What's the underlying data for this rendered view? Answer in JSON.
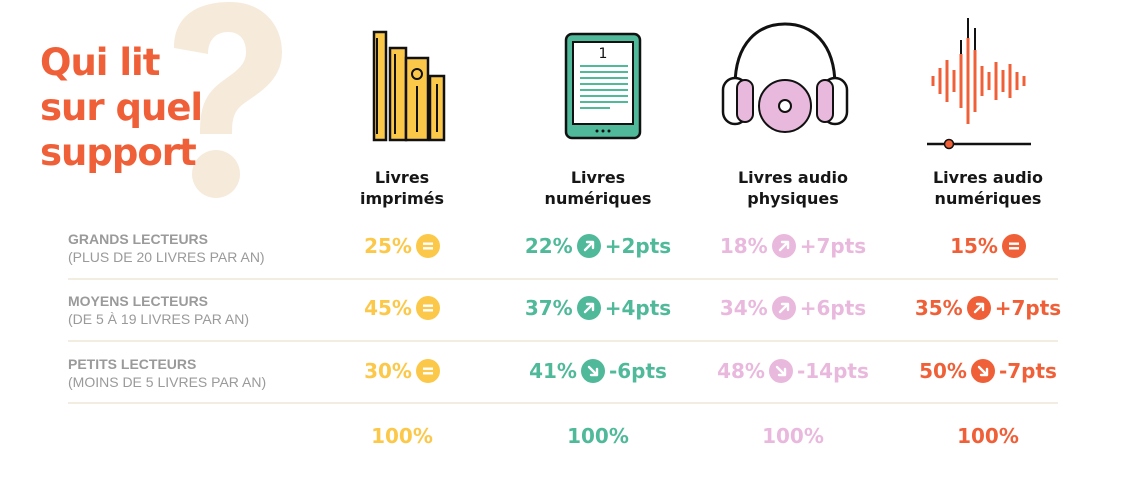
{
  "title": {
    "line1": "Qui lit",
    "line2": "sur quel",
    "line3": "support",
    "color": "#ef6038"
  },
  "question_mark_color": "#f6eadb",
  "columns": [
    {
      "line1": "Livres",
      "line2": "imprimés",
      "color": "#fcc84a",
      "icon": "books-icon",
      "total": "100%"
    },
    {
      "line1": "Livres",
      "line2": "numériques",
      "color": "#4fb99a",
      "icon": "ereader-icon",
      "total": "100%"
    },
    {
      "line1": "Livres audio",
      "line2": "physiques",
      "color": "#e9b8dd",
      "icon": "headphones-cd-icon",
      "total": "100%"
    },
    {
      "line1": "Livres audio",
      "line2": "numériques",
      "color": "#ef6038",
      "icon": "audio-waveform-icon",
      "total": "100%"
    }
  ],
  "ereader_page_number": "1",
  "rows": [
    {
      "name": "GRANDS LECTEURS",
      "sub": "(PLUS DE 20 LIVRES PAR AN)",
      "cells": [
        {
          "value": "25%",
          "trend": "equal",
          "delta": ""
        },
        {
          "value": "22%",
          "trend": "up",
          "delta": "+2pts"
        },
        {
          "value": "18%",
          "trend": "up",
          "delta": "+7pts"
        },
        {
          "value": "15%",
          "trend": "equal",
          "delta": ""
        }
      ]
    },
    {
      "name": "MOYENS LECTEURS",
      "sub": "(DE 5 À 19 LIVRES PAR AN)",
      "cells": [
        {
          "value": "45%",
          "trend": "equal",
          "delta": ""
        },
        {
          "value": "37%",
          "trend": "up",
          "delta": "+4pts"
        },
        {
          "value": "34%",
          "trend": "up",
          "delta": "+6pts"
        },
        {
          "value": "35%",
          "trend": "up",
          "delta": "+7pts"
        }
      ]
    },
    {
      "name": "PETITS LECTEURS",
      "sub": "(MOINS DE 5 LIVRES PAR AN)",
      "cells": [
        {
          "value": "30%",
          "trend": "equal",
          "delta": ""
        },
        {
          "value": "41%",
          "trend": "down",
          "delta": "-6pts"
        },
        {
          "value": "48%",
          "trend": "down",
          "delta": "-14pts"
        },
        {
          "value": "50%",
          "trend": "down",
          "delta": "-7pts"
        }
      ]
    }
  ]
}
